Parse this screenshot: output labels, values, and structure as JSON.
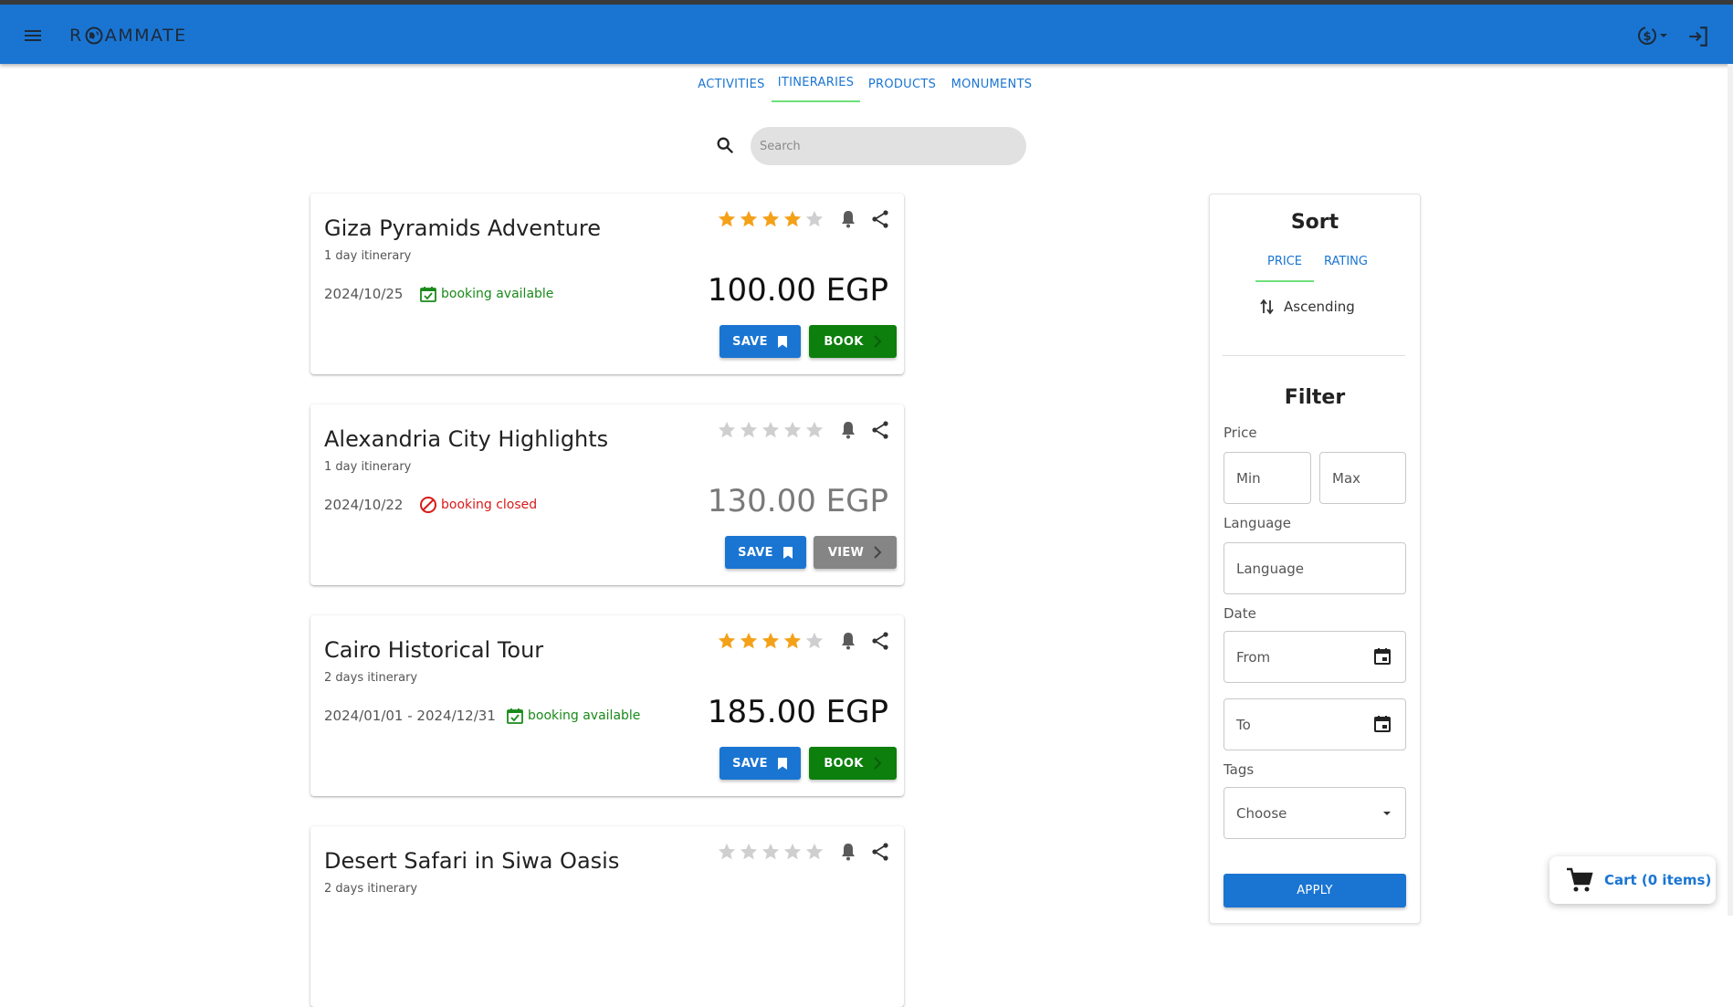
{
  "app": {
    "logo_text_left": "R",
    "logo_text_right": "AMMATE"
  },
  "tabs": [
    {
      "label": "ACTIVITIES"
    },
    {
      "label": "ITINERARIES"
    },
    {
      "label": "PRODUCTS"
    },
    {
      "label": "MONUMENTS"
    }
  ],
  "active_tab": "ITINERARIES",
  "search": {
    "placeholder": "Search",
    "value": ""
  },
  "cards": [
    {
      "title": "Giza Pyramids Adventure",
      "subtitle": "1 day itinerary",
      "date": "2024/10/25",
      "booking": "booking available",
      "booking_status": "available",
      "rating": 4,
      "price": "100.00 EGP",
      "save_label": "SAVE",
      "action_label": "BOOK"
    },
    {
      "title": "Alexandria City Highlights",
      "subtitle": "1 day itinerary",
      "date": "2024/10/22",
      "booking": "booking closed",
      "booking_status": "closed",
      "rating": 0,
      "price": "130.00 EGP",
      "save_label": "SAVE",
      "action_label": "VIEW"
    },
    {
      "title": "Cairo Historical Tour",
      "subtitle": "2 days itinerary",
      "date": "2024/01/01 - 2024/12/31",
      "booking": "booking available",
      "booking_status": "available",
      "rating": 4,
      "price": "185.00 EGP",
      "save_label": "SAVE",
      "action_label": "BOOK"
    },
    {
      "title": "Desert Safari in Siwa Oasis",
      "subtitle": "2 days itinerary",
      "rating": 0
    }
  ],
  "sort": {
    "heading": "Sort",
    "tabs": [
      {
        "label": "PRICE"
      },
      {
        "label": "RATING"
      }
    ],
    "active": "PRICE",
    "order_label": "Ascending"
  },
  "filter": {
    "heading": "Filter",
    "price_label": "Price",
    "min_placeholder": "Min",
    "max_placeholder": "Max",
    "language_label": "Language",
    "language_placeholder": "Language",
    "date_label": "Date",
    "from_placeholder": "From",
    "to_placeholder": "To",
    "tags_label": "Tags",
    "tags_value": "Choose",
    "apply_label": "APPLY"
  },
  "cart": {
    "label": "Cart (0 items)"
  },
  "colors": {
    "primary": "#1a75d2",
    "book_green": "#0c7f0c",
    "view_gray": "#858585",
    "star_gold": "#f4a11a",
    "star_empty": "#cfcfcf",
    "available_green": "#1a8a1a",
    "closed_red": "#d81b1b",
    "tab_indicator": "#6ee07a"
  }
}
